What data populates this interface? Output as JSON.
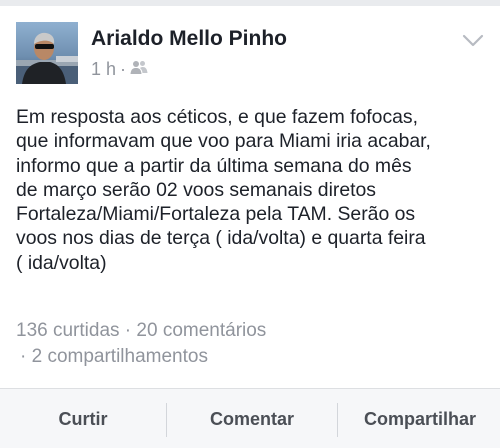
{
  "post": {
    "author": "Arialdo Mello Pinho",
    "time": "1 h",
    "separator": "·",
    "audience_icon": "friends-icon",
    "menu_icon": "chevron-down-icon",
    "text_lines": [
      "Em resposta aos céticos, e que fazem fofocas,",
      "que informavam que voo para Miami iria acabar,",
      "informo que a partir da última semana do mês",
      "de março serão 02 voos semanais diretos",
      "Fortaleza/Miami/Fortaleza pela TAM. Serão os",
      "voos nos dias de terça ( ida/volta) e quarta feira",
      "( ida/volta)"
    ]
  },
  "stats": {
    "likes": "136 curtidas",
    "separator": "·",
    "comments": "20 comentários",
    "shares": "2 compartilhamentos"
  },
  "actions": {
    "like": "Curtir",
    "comment": "Comentar",
    "share": "Compartilhar"
  },
  "colors": {
    "text": "#1d2129",
    "meta": "#90949c",
    "action_text": "#4b4f56",
    "action_bar": "#f6f7f9",
    "page_bg": "#e9ebee"
  }
}
